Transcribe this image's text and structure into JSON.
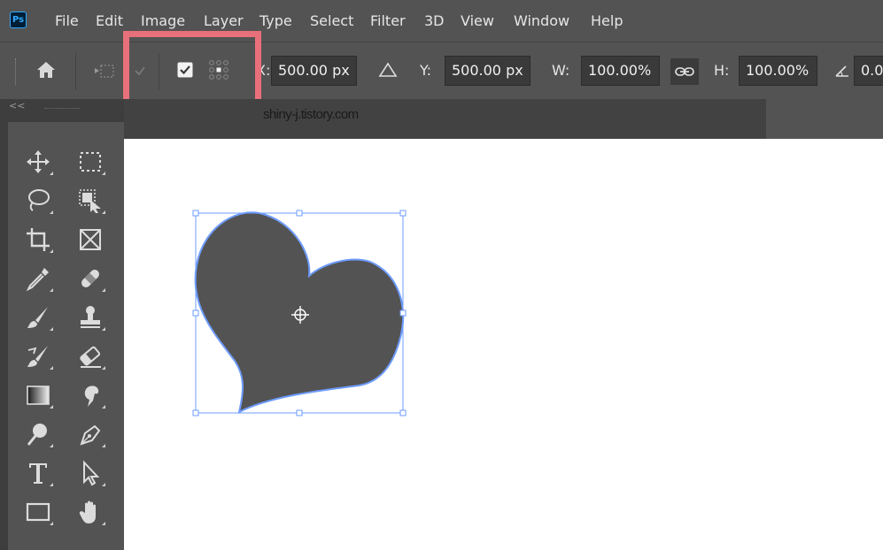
{
  "app": {
    "logo_text": "Ps"
  },
  "menu": [
    "File",
    "Edit",
    "Image",
    "Layer",
    "Type",
    "Select",
    "Filter",
    "3D",
    "View",
    "Window",
    "Help"
  ],
  "options_bar": {
    "x_label": "X:",
    "x_value": "500.00 px",
    "y_label": "Y:",
    "y_value": "500.00 px",
    "w_label": "W:",
    "w_value": "100.00%",
    "h_label": "H:",
    "h_value": "100.00%",
    "angle_value": "0.0",
    "reference_point_checked": true
  },
  "panel": {
    "collapse_label": "<<"
  },
  "document": {
    "watermark": "shiny-j.tistory.com"
  },
  "highlight_color": "#e8707a",
  "shape_color": "#535353",
  "selection_color": "#6e9cff",
  "tools": [
    [
      "move-tool-icon",
      "marquee-tool-icon"
    ],
    [
      "lasso-tool-icon",
      "object-selection-tool-icon"
    ],
    [
      "crop-tool-icon",
      "frame-tool-icon"
    ],
    [
      "eyedropper-tool-icon",
      "healing-brush-tool-icon"
    ],
    [
      "brush-tool-icon",
      "clone-stamp-tool-icon"
    ],
    [
      "history-brush-tool-icon",
      "eraser-tool-icon"
    ],
    [
      "gradient-tool-icon",
      "smudge-tool-icon"
    ],
    [
      "dodge-tool-icon",
      "pen-tool-icon"
    ],
    [
      "type-tool-icon",
      "path-selection-tool-icon"
    ],
    [
      "rectangle-tool-icon",
      "hand-tool-icon"
    ]
  ]
}
